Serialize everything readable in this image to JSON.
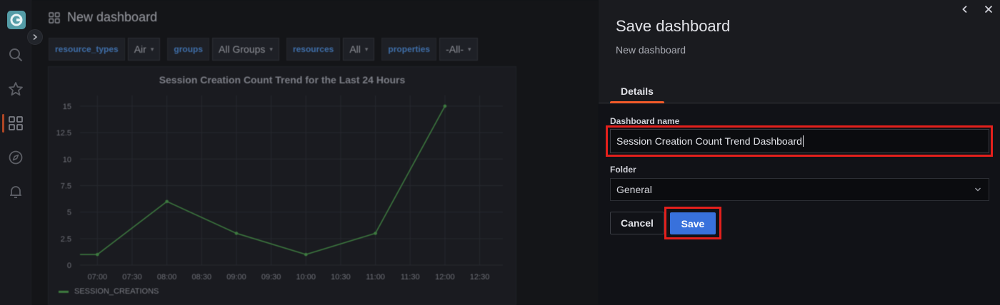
{
  "dashboard": {
    "title": "New dashboard",
    "variables": [
      {
        "label": "resource_types",
        "value": "Air"
      },
      {
        "label": "groups",
        "value": "All Groups"
      },
      {
        "label": "resources",
        "value": "All"
      },
      {
        "label": "properties",
        "value": "-All-"
      }
    ],
    "panel": {
      "title": "Session Creation Count Trend for the Last 24 Hours",
      "legend": "SESSION_CREATIONS"
    }
  },
  "chart_data": {
    "type": "line",
    "title": "Session Creation Count Trend for the Last 24 Hours",
    "x": [
      "07:00",
      "07:30",
      "08:00",
      "08:30",
      "09:00",
      "09:30",
      "10:00",
      "10:30",
      "11:00",
      "11:30",
      "12:00",
      "12:30"
    ],
    "series": [
      {
        "name": "SESSION_CREATIONS",
        "points": [
          {
            "x": "06:45",
            "y": 1
          },
          {
            "x": "07:00",
            "y": 1
          },
          {
            "x": "08:00",
            "y": 6
          },
          {
            "x": "09:00",
            "y": 3
          },
          {
            "x": "10:00",
            "y": 1
          },
          {
            "x": "11:00",
            "y": 3
          },
          {
            "x": "12:00",
            "y": 15
          }
        ]
      }
    ],
    "yticks": [
      "0",
      "2.5",
      "5",
      "7.5",
      "10",
      "12.5",
      "15"
    ],
    "ylim": [
      0,
      16
    ],
    "grid": true,
    "legend_position": "bottom-left",
    "color": "#3d7a3f"
  },
  "drawer": {
    "title": "Save dashboard",
    "subtitle": "New dashboard",
    "tab": "Details",
    "name_label": "Dashboard name",
    "name_value": "Session Creation Count Trend Dashboard",
    "folder_label": "Folder",
    "folder_value": "General",
    "cancel_label": "Cancel",
    "save_label": "Save"
  },
  "icons": {
    "sidebar": [
      "grafana-logo-icon",
      "search-icon",
      "star-icon",
      "dashboards-grid-icon",
      "explore-compass-icon",
      "alerting-bell-icon"
    ],
    "drawer": [
      "collapse-chevron-left-icon",
      "close-icon"
    ]
  },
  "colors": {
    "accent": "#f15a29",
    "primary_button": "#3871dc",
    "highlight": "#e4201c",
    "series": "#3d7a3f"
  }
}
